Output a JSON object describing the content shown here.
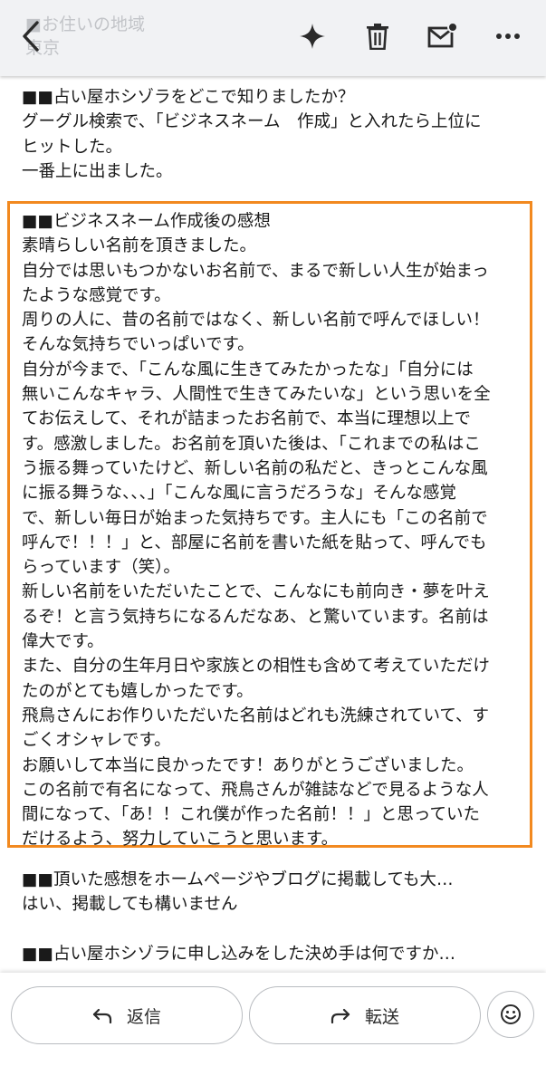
{
  "header": {
    "ghost_line1": "■お住いの地域",
    "ghost_line2": "東京"
  },
  "email": {
    "section1": "■■占い屋ホシゾラをどこで知りましたか？\nグーグル検索で、「ビジネスネーム　作成」と入れたら上位に\nヒットした。\n一番上に出ました。",
    "section2": "■■ビジネスネーム作成後の感想\n素晴らしい名前を頂きました。\n自分では思いもつかないお名前で、まるで新しい人生が始まっ\nたような感覚です。\n周りの人に、昔の名前ではなく、新しい名前で呼んでほしい！\nそんな気持ちでいっぱいです。\n自分が今まで、「こんな風に生きてみたかったな」「自分には\n無いこんなキャラ、人間性で生きてみたいな」という思いを全\nてお伝えして、それが詰まったお名前で、本当に理想以上で\nす。感激しました。お名前を頂いた後は、「これまでの私はこ\nう振る舞っていたけど、新しい名前の私だと、きっとこんな風\nに振る舞うな、、、」「こんな風に言うだろうな」そんな感覚\nで、新しい毎日が始まった気持ちです。主人にも「この名前で\n呼んで！！！」と、部屋に名前を書いた紙を貼って、呼んでも\nらっています（笑）。\n新しい名前をいただいたことで、こんなにも前向き・夢を叶え\nるぞ！と言う気持ちになるんだなあ、と驚いています。名前は\n偉大です。\nまた、自分の生年月日や家族との相性も含めて考えていただけ\nたのがとても嬉しかったです。\n飛鳥さんにお作りいただいた名前はどれも洗練されていて、す\nごくオシャレです。\nお願いして本当に良かったです！ありがとうございました。\nこの名前で有名になって、飛鳥さんが雑誌などで見るような人\n間になって、「あ！！これ僕が作った名前！！」と思っていた\nだけるよう、努力していこうと思います。",
    "section3": "■■頂いた感想をホームページやブログに掲載しても大…\nはい、掲載しても構いません",
    "section4": "■■占い屋ホシゾラに申し込みをした決め手は何ですか…"
  },
  "actions": {
    "reply_label": "返信",
    "forward_label": "転送"
  },
  "icons": {
    "back": "chevron-left-icon",
    "ai": "sparkle-icon",
    "delete": "trash-icon",
    "mark_unread": "mail-unread-icon",
    "menu": "more-horizontal-icon",
    "reply": "reply-arrow-icon",
    "forward": "forward-arrow-icon",
    "react": "emoji-icon"
  },
  "colors": {
    "highlight_border": "#f2891f",
    "toolbar_bg": "#f1f2f4"
  }
}
